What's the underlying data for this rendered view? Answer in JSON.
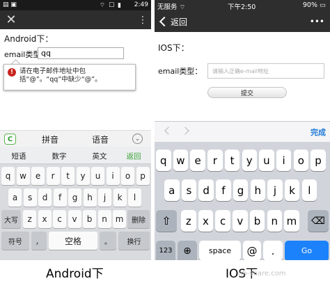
{
  "android": {
    "status": {
      "left": "▤  ▣",
      "icons": "⌔ ☐ ▮",
      "time": "2:49"
    },
    "close_glyph": "✕",
    "more_glyph": "⋮",
    "heading": "Android下：",
    "email_label": "email类型：",
    "email_value": "qq",
    "tooltip_icon": "!",
    "tooltip_text": "请在电子邮件地址中包括“@”。“qq”中缺少“@”。",
    "ime": {
      "logo": "C",
      "pinyin": "拼音",
      "voice": "语音",
      "collapse": "⌄"
    },
    "modes": [
      "短语",
      "数字",
      "英文",
      "返回"
    ],
    "row1": [
      "q",
      "w",
      "e",
      "r",
      "t",
      "y",
      "u",
      "i",
      "o",
      "p"
    ],
    "row2": [
      "a",
      "s",
      "d",
      "f",
      "g",
      "h",
      "j",
      "k",
      "l"
    ],
    "row3": [
      "z",
      "x",
      "c",
      "v",
      "b",
      "n",
      "m"
    ],
    "shift_label": "大写",
    "delete_label": "删除",
    "symbol_label": "符号",
    "comma_label": "，",
    "space_label": "空格",
    "period_label": "。",
    "enter_label": "换行"
  },
  "ios": {
    "status": {
      "carrier": "无服务 ⌔",
      "time": "下午2:50",
      "battery": "90% ▭"
    },
    "back_label": "返回",
    "more_glyph": "•••",
    "heading": "IOS下：",
    "email_label": "email类型：",
    "email_placeholder": "请输入正确e-mail地址",
    "submit_label": "提交",
    "done_label": "完成",
    "row1": [
      "q",
      "w",
      "e",
      "r",
      "t",
      "y",
      "u",
      "i",
      "o",
      "p"
    ],
    "row2": [
      "a",
      "s",
      "d",
      "f",
      "g",
      "h",
      "j",
      "k",
      "l"
    ],
    "row3": [
      "z",
      "x",
      "c",
      "v",
      "b",
      "n",
      "m"
    ],
    "num_label": "123",
    "globe_glyph": "⊕",
    "space_label": "space",
    "at_label": "@",
    "dot_label": ".",
    "go_label": "Go"
  },
  "captions": {
    "android": "Android下",
    "ios": "IOS下"
  },
  "watermark": "hb-share.com"
}
